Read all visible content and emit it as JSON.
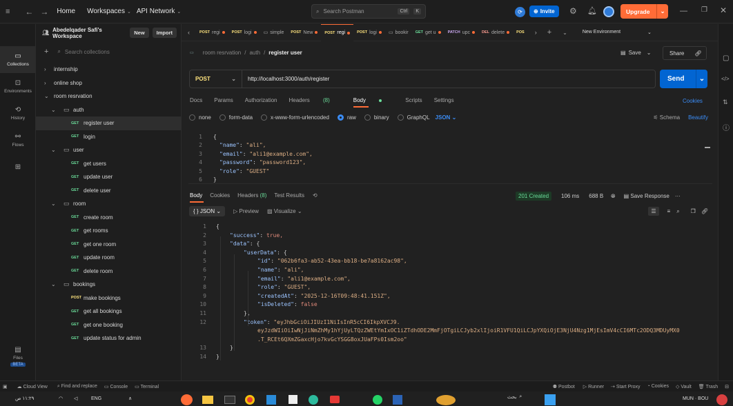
{
  "topbar": {
    "home": "Home",
    "workspaces": "Workspaces",
    "api_network": "API Network",
    "search_placeholder": "Search Postman",
    "shortcut_ctrl": "Ctrl",
    "shortcut_k": "K",
    "invite": "Invite",
    "upgrade": "Upgrade"
  },
  "workspace": {
    "name": "Abedelqader Safi's Workspace",
    "new": "New",
    "import": "Import"
  },
  "rail": [
    {
      "label": "Collections"
    },
    {
      "label": "Environments"
    },
    {
      "label": "History"
    },
    {
      "label": "Flows"
    },
    {
      "label": "Files"
    },
    {
      "label": "BETA"
    }
  ],
  "sidebar": {
    "search_placeholder": "Search collections",
    "tree": [
      {
        "type": "collection",
        "label": "internship"
      },
      {
        "type": "collection",
        "label": "online shop"
      },
      {
        "type": "collection",
        "label": "room resrvation"
      },
      {
        "type": "folder",
        "label": "auth"
      },
      {
        "type": "req",
        "method": "GET",
        "label": "register user"
      },
      {
        "type": "req",
        "method": "GET",
        "label": "login"
      },
      {
        "type": "folder",
        "label": "user"
      },
      {
        "type": "req",
        "method": "GET",
        "label": "get users"
      },
      {
        "type": "req",
        "method": "GET",
        "label": "update user"
      },
      {
        "type": "req",
        "method": "GET",
        "label": "delete user"
      },
      {
        "type": "folder",
        "label": "room"
      },
      {
        "type": "req",
        "method": "GET",
        "label": "create room"
      },
      {
        "type": "req",
        "method": "GET",
        "label": "get rooms"
      },
      {
        "type": "req",
        "method": "GET",
        "label": "get one room"
      },
      {
        "type": "req",
        "method": "GET",
        "label": "update room"
      },
      {
        "type": "req",
        "method": "GET",
        "label": "delete room"
      },
      {
        "type": "folder",
        "label": "bookings"
      },
      {
        "type": "req",
        "method": "POST",
        "label": "make bookings"
      },
      {
        "type": "req",
        "method": "GET",
        "label": "get all bookings"
      },
      {
        "type": "req",
        "method": "GET",
        "label": "get one booking"
      },
      {
        "type": "req",
        "method": "GET",
        "label": "update status for admin"
      }
    ]
  },
  "tabs": [
    {
      "method": "POST",
      "label": "regi",
      "dot": true
    },
    {
      "method": "POST",
      "label": "logi",
      "dot": true
    },
    {
      "method": "",
      "label": "simple",
      "dot": false
    },
    {
      "method": "POST",
      "label": "New",
      "dot": true
    },
    {
      "method": "POST",
      "label": "regi",
      "dot": true,
      "active": true
    },
    {
      "method": "POST",
      "label": "logi",
      "dot": true
    },
    {
      "method": "",
      "label": "bookir",
      "dot": false
    },
    {
      "method": "GET",
      "label": "get u",
      "dot": true
    },
    {
      "method": "PATCH",
      "label": "upc",
      "dot": true
    },
    {
      "method": "DEL",
      "label": "delete",
      "dot": true
    },
    {
      "method": "POS",
      "label": "",
      "dot": false
    }
  ],
  "environment": "New Environment",
  "breadcrumb": {
    "collection": "room resrvation",
    "folder": "auth",
    "current": "register user"
  },
  "actions": {
    "save": "Save",
    "share": "Share"
  },
  "request": {
    "method": "POST",
    "url": "http://localhost:3000/auth/register",
    "send": "Send"
  },
  "request_tabs": {
    "docs": "Docs",
    "params": "Params",
    "authorization": "Authorization",
    "headers": "Headers",
    "headers_count": "(8)",
    "body": "Body",
    "scripts": "Scripts",
    "settings": "Settings",
    "cookies": "Cookies"
  },
  "body_types": {
    "none": "none",
    "form_data": "form-data",
    "urlencoded": "x-www-form-urlencoded",
    "raw": "raw",
    "binary": "binary",
    "graphql": "GraphQL",
    "json": "JSON",
    "schema": "Schema",
    "beautify": "Beautify"
  },
  "request_body": [
    {
      "n": "1",
      "text": "{"
    },
    {
      "n": "2",
      "key": "\"name\"",
      "val": "\"ali\","
    },
    {
      "n": "3",
      "key": "\"email\"",
      "val": "\"ali1@example.com\","
    },
    {
      "n": "4",
      "key": "\"password\"",
      "val": "\"password123\","
    },
    {
      "n": "5",
      "key": "\"role\"",
      "val": "\"GUEST\""
    },
    {
      "n": "6",
      "text": "}"
    }
  ],
  "response_tabs": {
    "body": "Body",
    "cookies": "Cookies",
    "headers": "Headers",
    "headers_count": "(8)",
    "test_results": "Test Results"
  },
  "response_meta": {
    "status": "201 Created",
    "time": "106 ms",
    "size": "688 B",
    "save_response": "Save Response"
  },
  "response_view": {
    "format": "JSON",
    "preview": "Preview",
    "visualize": "Visualize"
  },
  "response_body": [
    {
      "n": "1",
      "indent": 0,
      "text": "{"
    },
    {
      "n": "2",
      "indent": 1,
      "key": "\"success\"",
      "val": "true,",
      "bool": true
    },
    {
      "n": "3",
      "indent": 1,
      "key": "\"data\"",
      "text": "{"
    },
    {
      "n": "4",
      "indent": 2,
      "key": "\"userData\"",
      "text": "{"
    },
    {
      "n": "5",
      "indent": 3,
      "key": "\"id\"",
      "val": "\"062b6fa3-ab52-43ea-bb18-be7a8162ac98\","
    },
    {
      "n": "6",
      "indent": 3,
      "key": "\"name\"",
      "val": "\"ali\","
    },
    {
      "n": "7",
      "indent": 3,
      "key": "\"email\"",
      "val": "\"ali1@example.com\","
    },
    {
      "n": "8",
      "indent": 3,
      "key": "\"role\"",
      "val": "\"GUEST\","
    },
    {
      "n": "9",
      "indent": 3,
      "key": "\"createdAt\"",
      "val": "\"2025-12-16T09:48:41.151Z\","
    },
    {
      "n": "10",
      "indent": 3,
      "key": "\"isDeleted\"",
      "val": "false",
      "bool": true
    },
    {
      "n": "11",
      "indent": 2,
      "text": "},"
    },
    {
      "n": "12",
      "indent": 2,
      "key": "\"token\"",
      "val": "\"eyJhbGciOiJIUzI1NiIsInR5cCI6IkpXVCJ9."
    },
    {
      "n": "",
      "indent": 3,
      "cont": "eyJzdWIiOiIwNjJiNmZhMy1hYjUyLTQzZWEtYmIxOC1iZTdhODE2MmFjOTgiLCJyb2xlIjoiR1VFU1QiLCJpYXQiOjE3NjU4Nzg1MjEsImV4cCI6MTc2ODQ3MDUyMX0"
    },
    {
      "n": "",
      "indent": 3,
      "cont": ".T_RCEt6QXmZGaxcHjo7kvGcYSGG8oxJUaFPs0Ism2oo\""
    },
    {
      "n": "13",
      "indent": 1,
      "text": "}"
    },
    {
      "n": "14",
      "indent": 0,
      "text": "}"
    }
  ],
  "statusbar": {
    "cloud_view": "Cloud View",
    "find_replace": "Find and replace",
    "console": "Console",
    "terminal": "Terminal",
    "postbot": "Postbot",
    "runner": "Runner",
    "start_proxy": "Start Proxy",
    "cookies": "Cookies",
    "vault": "Vault",
    "trash": "Trash"
  },
  "taskbar": {
    "time": "١١:٢٩ ص",
    "lang": "ENG",
    "search": "بحث",
    "user": "MUN · BOU"
  },
  "colors": {
    "accent": "#ff6c37",
    "send": "#0265d2",
    "status_ok": "#6bdd9a"
  }
}
